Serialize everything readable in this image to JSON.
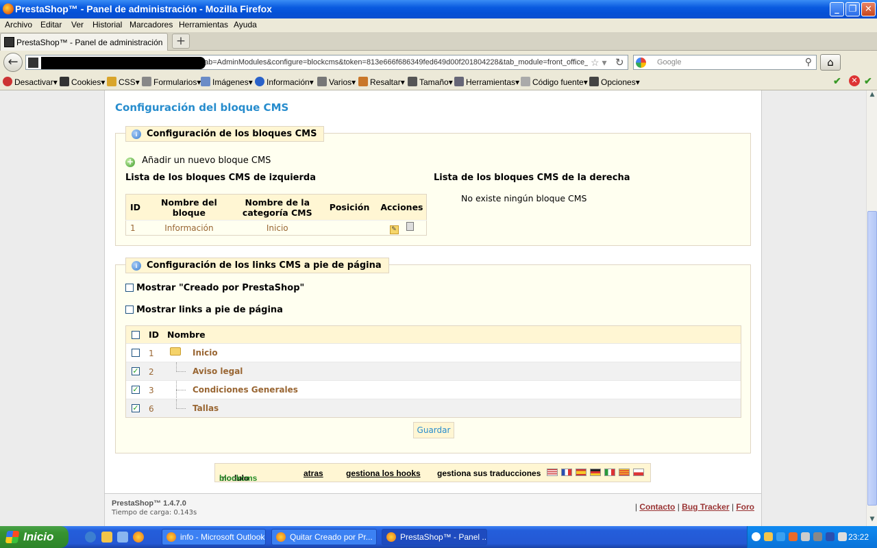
{
  "window": {
    "title": "PrestaShop™ - Panel de administración - Mozilla Firefox"
  },
  "menu": [
    "Archivo",
    "Editar",
    "Ver",
    "Historial",
    "Marcadores",
    "Herramientas",
    "Ayuda"
  ],
  "tab": {
    "title": "PrestaShop™ - Panel de administración"
  },
  "url": "ab=AdminModules&configure=blockcms&token=813e666f686349fed649d00f201804228&tab_module=front_office_fe",
  "search": {
    "placeholder": "Google"
  },
  "devbar": [
    "Desactivar",
    "Cookies",
    "CSS",
    "Formularios",
    "Imágenes",
    "Información",
    "Varios",
    "Resaltar",
    "Tamaño",
    "Herramientas",
    "Código fuente",
    "Opciones"
  ],
  "page": {
    "title": "Configuración del bloque CMS",
    "blocks": {
      "legend": "Configuración de los bloques CMS",
      "add_link": "Añadir un nuevo bloque CMS",
      "left_title": "Lista de los bloques CMS de izquierda",
      "right_title": "Lista de los bloques CMS de la derecha",
      "right_empty": "No existe ningún bloque CMS",
      "table": {
        "headers": [
          "ID",
          "Nombre del bloque",
          "Nombre de la categoría CMS",
          "Posición",
          "Acciones"
        ],
        "rows": [
          {
            "id": "1",
            "name": "Información",
            "category": "Inicio"
          }
        ]
      }
    },
    "footer_links": {
      "legend": "Configuración de los links CMS a pie de página",
      "opt1": "Mostrar \"Creado por PrestaShop\"",
      "opt2": "Mostrar links a pie de página",
      "headers": [
        "ID",
        "Nombre"
      ],
      "rows": [
        {
          "id": "1",
          "name": "Inicio",
          "checked": false
        },
        {
          "id": "2",
          "name": "Aviso legal",
          "checked": true
        },
        {
          "id": "3",
          "name": "Condiciones Generales",
          "checked": true
        },
        {
          "id": "6",
          "name": "Tallas",
          "checked": true
        }
      ],
      "save": "Guardar"
    },
    "module_bar": {
      "prefix": "modulo",
      "module": "blockcms",
      "back": "atras",
      "hooks": "gestiona los hooks",
      "translations": "gestiona sus traducciones"
    },
    "footer": {
      "version": "PrestaShop™ 1.4.7.0",
      "load": "Tiempo de carga: 0.143s",
      "contact": "Contacto",
      "bug": "Bug Tracker",
      "forum": "Foro"
    }
  },
  "taskbar": {
    "start": "Inicio",
    "items": [
      "info - Microsoft Outlook",
      "Quitar Creado por Pr...",
      "PrestaShop™ - Panel ..."
    ],
    "clock": "23:22"
  }
}
